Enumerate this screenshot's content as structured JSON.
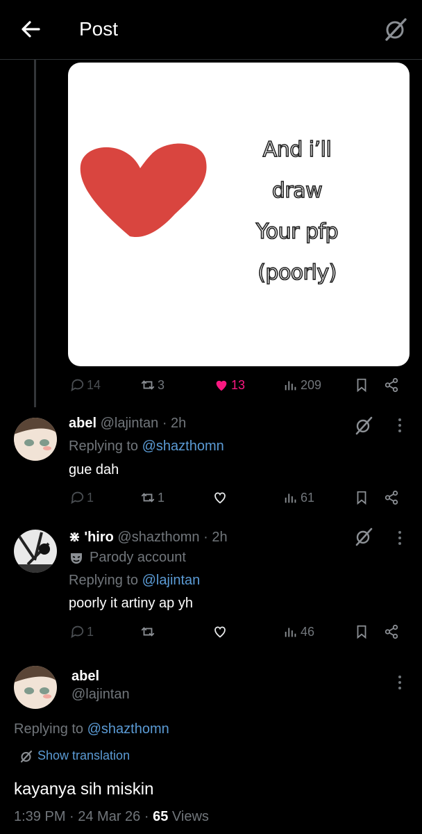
{
  "header": {
    "title": "Post"
  },
  "original_post": {
    "image_text": [
      "And i’ll",
      "draw",
      "Your pfp",
      "(poorly)"
    ],
    "replies": "14",
    "reposts": "3",
    "likes": "13",
    "views": "209"
  },
  "replies": [
    {
      "display_name": "abel",
      "handle": "@lajintan",
      "time": "· 2h",
      "replying_prefix": "Replying to",
      "replying_to": "@shazthomn",
      "text": "gue dah",
      "reply_count": "1",
      "repost_count": "1",
      "views": "61"
    },
    {
      "display_name": "⋇ 'hiro",
      "handle": "@shazthomn",
      "time": "· 2h",
      "badge": "Parody account",
      "replying_prefix": "Replying to",
      "replying_to": "@lajintan",
      "text": "poorly it artiny ap yh",
      "reply_count": "1",
      "views": "46"
    }
  ],
  "main_post": {
    "display_name": "abel",
    "handle": "@lajintan",
    "replying_prefix": "Replying to",
    "replying_to": "@shazthomn",
    "translate_label": "Show translation",
    "text": "kayanya sih miskin",
    "timestamp": "1:39 PM · 24 Mar 26 ·",
    "views_count": "65",
    "views_label": "Views"
  },
  "colors": {
    "like": "#f91880",
    "link": "#5b9bd5",
    "muted": "#71767b",
    "heart": "#d9453f"
  }
}
